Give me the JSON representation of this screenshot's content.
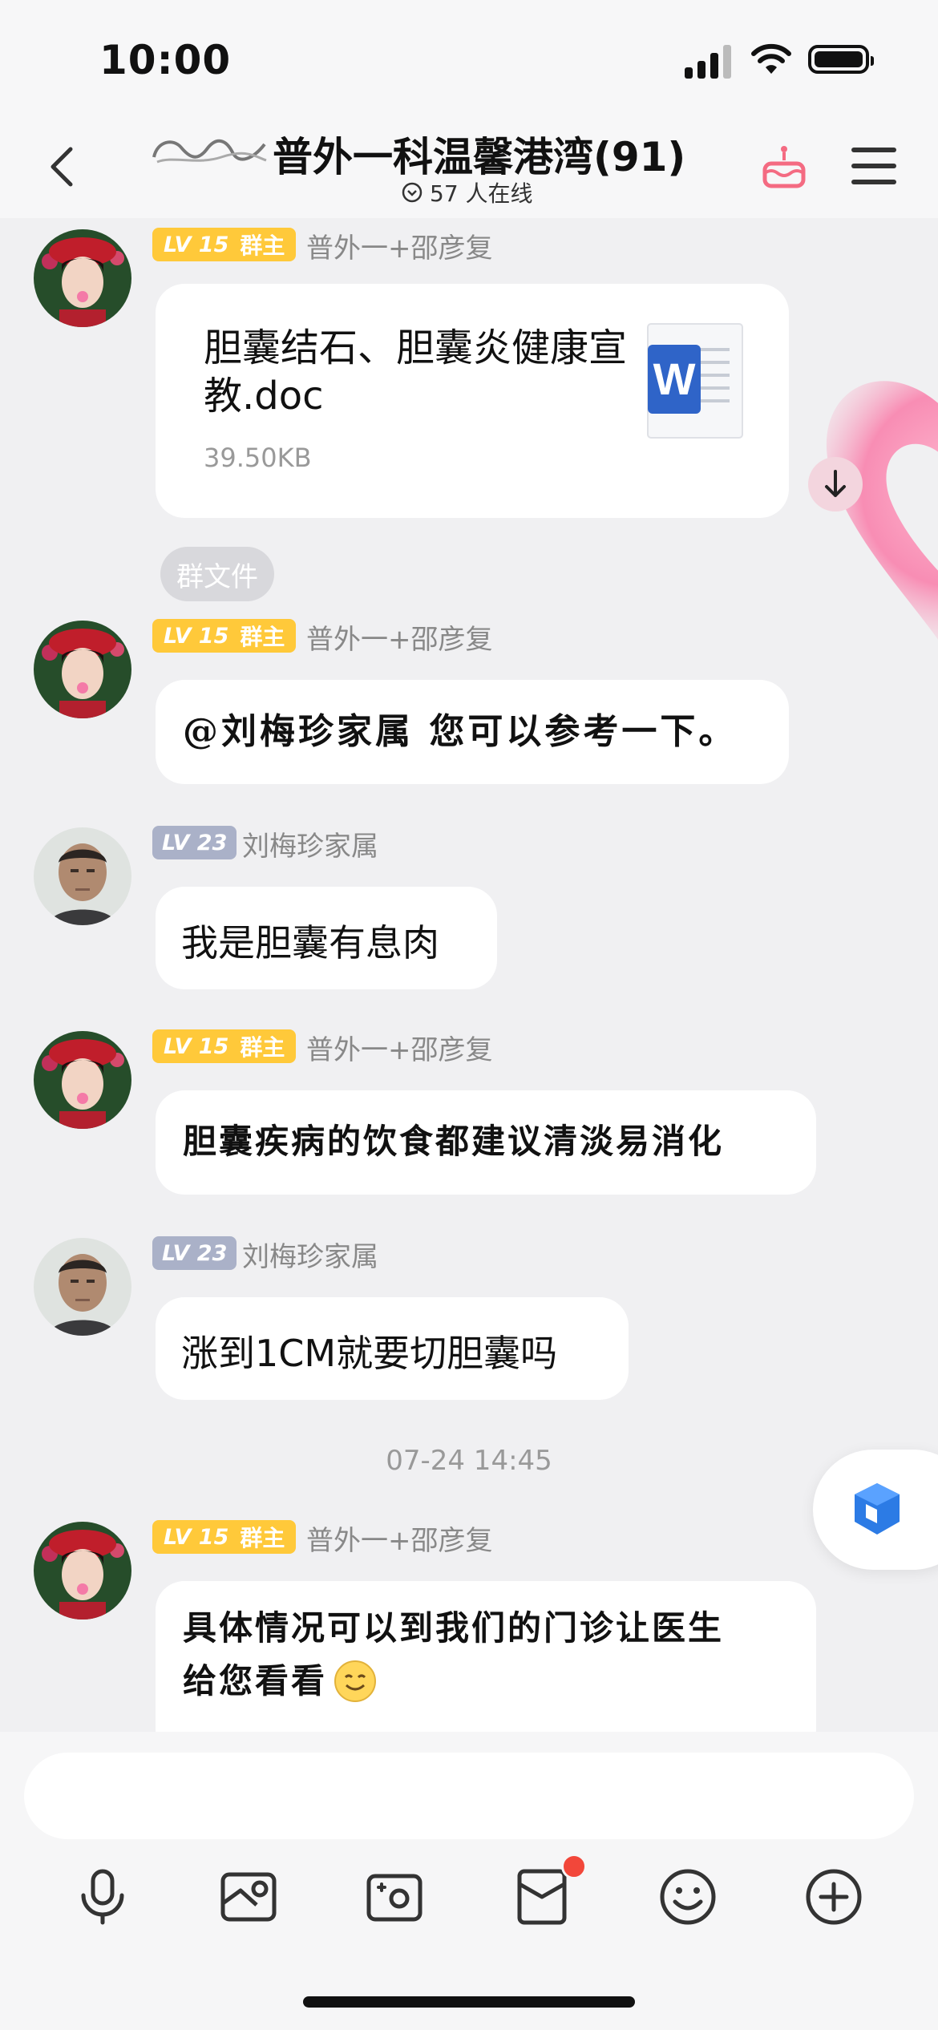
{
  "status": {
    "time": "10:00"
  },
  "header": {
    "group_name": "普外一科温馨港湾(91)",
    "online": "57 人在线"
  },
  "messages": [
    {
      "level": "LV 15",
      "role": "群主",
      "sender": "普外一+邵彦复",
      "file_name": "胆囊结石、胆囊炎健康宣教.doc",
      "file_size": "39.50KB",
      "file_type": "word-document-icon"
    },
    {
      "tag": "群文件"
    },
    {
      "level": "LV 15",
      "role": "群主",
      "sender": "普外一+邵彦复",
      "text": "@刘梅珍家属 您可以参考一下。"
    },
    {
      "level": "LV 23",
      "sender": "刘梅珍家属",
      "text": "我是胆囊有息肉"
    },
    {
      "level": "LV 15",
      "role": "群主",
      "sender": "普外一+邵彦复",
      "text": "胆囊疾病的饮食都建议清淡易消化"
    },
    {
      "level": "LV 23",
      "sender": "刘梅珍家属",
      "text": "涨到1CM就要切胆囊吗"
    },
    {
      "timestamp": "07-24 14:45"
    },
    {
      "level": "LV 15",
      "role": "群主",
      "sender": "普外一+邵彦复",
      "text_line1": "具体情况可以到我们的门诊让医生",
      "text_line2": "给您看看"
    }
  ],
  "input": {
    "placeholder": ""
  },
  "toolbar": [
    "microphone-icon",
    "image-icon",
    "camera-icon",
    "red-packet-icon",
    "emoji-icon",
    "plus-icon"
  ],
  "colors": {
    "owner_badge": "#ffc93a",
    "member_badge": "#aab1c8",
    "background": "#f0f0f2",
    "notification_dot": "#f2473a"
  }
}
